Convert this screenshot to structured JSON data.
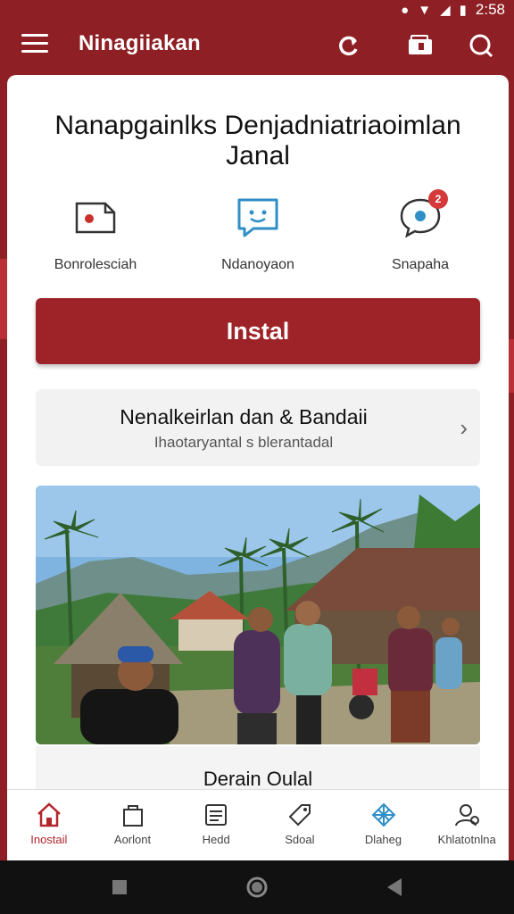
{
  "status": {
    "time": "2:58"
  },
  "app_bar": {
    "title": "Ninagiiakan",
    "icons": [
      "menu-icon",
      "refresh-icon",
      "wallet-icon",
      "search-icon"
    ]
  },
  "hero": {
    "title": "Nanapgainlks Denjadniatriaoimlan Janal"
  },
  "quick_actions": [
    {
      "label": "Bonrolesciah",
      "icon": "document-icon"
    },
    {
      "label": "Ndanoyaon",
      "icon": "chat-face-icon"
    },
    {
      "label": "Snapaha",
      "icon": "message-bubble-icon",
      "badge": "2"
    }
  ],
  "install": {
    "label": "Instal"
  },
  "info_row": {
    "title": "Nenalkeirlan dan & Bandaii",
    "subtitle": "Ihaotaryantal s blerantadal"
  },
  "photo": {
    "icon": "village-photo"
  },
  "caption": {
    "text": "Derain Oulal"
  },
  "bottom_nav": [
    {
      "label": "Inostail",
      "icon": "home-icon",
      "active": true
    },
    {
      "label": "Aorlont",
      "icon": "bag-icon"
    },
    {
      "label": "Hedd",
      "icon": "list-icon"
    },
    {
      "label": "Sdoal",
      "icon": "tag-icon"
    },
    {
      "label": "Dlaheg",
      "icon": "network-icon"
    },
    {
      "label": "Khlatotnlna",
      "icon": "user-icon"
    }
  ],
  "colors": {
    "brand": "#8e1f24",
    "accent": "#9e2328",
    "badge": "#d43a3a",
    "info_icon": "#2f8fc6"
  }
}
